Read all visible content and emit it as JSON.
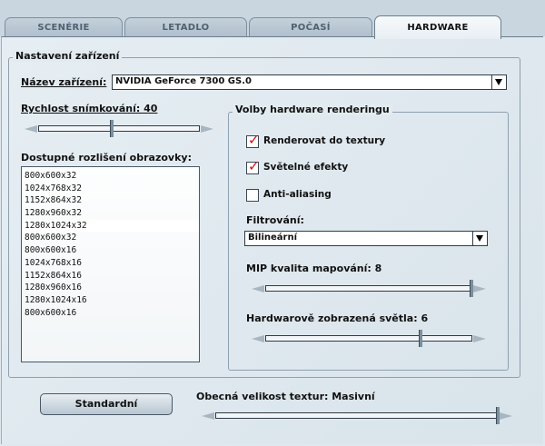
{
  "tabs": [
    {
      "label": "SCENÉRIE"
    },
    {
      "label": "LETADLO"
    },
    {
      "label": "POČASÍ"
    },
    {
      "label": "HARDWARE"
    }
  ],
  "device_settings": {
    "title": "Nastavení zařízení",
    "device_name_label": "Název zařízení:",
    "device_name_value": "NVIDIA GeForce 7300 GS.0",
    "frame_rate_label": "Rychlost snímkování: 40",
    "frame_rate_level": 0.45,
    "resolutions_label": "Dostupné rozlišení obrazovky:",
    "resolutions": [
      "800x600x32",
      "1024x768x32",
      "1152x864x32",
      "1280x960x32",
      "1280x1024x32",
      "800x600x32",
      "800x600x16",
      "1024x768x16",
      "1152x864x16",
      "1280x960x16",
      "1280x1024x16",
      "800x600x16"
    ],
    "selected_resolution_index": 4
  },
  "rendering": {
    "title": "Volby hardware renderingu",
    "options": [
      {
        "label": "Renderovat do textury",
        "checked": true
      },
      {
        "label": "Světelné efekty",
        "checked": true
      },
      {
        "label": "Anti-aliasing",
        "checked": false
      }
    ],
    "filtering_label": "Filtrování:",
    "filtering_value": "Bilineární",
    "mip_label": "MIP kvalita mapování: 8",
    "mip_level": 1.0,
    "lights_label": "Hardwarově zobrazená světla: 6",
    "lights_level": 0.75
  },
  "standard_button": "Standardní",
  "texture_size_label": "Obecná velikost textur: Masivní",
  "texture_size_level": 1.0
}
